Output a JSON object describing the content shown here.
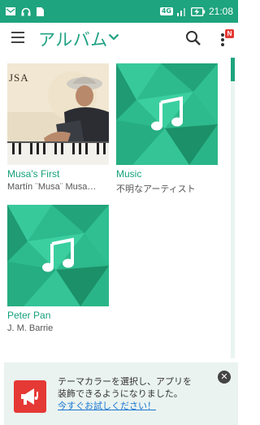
{
  "status_bar": {
    "network_badge": "4G",
    "time": "21:08",
    "icons": [
      "mail-icon",
      "headphones-icon",
      "document-icon",
      "signal-icon",
      "battery-charging-icon"
    ]
  },
  "app_bar": {
    "title": "アルバム",
    "icons": [
      "menu-icon",
      "chevron-down-icon",
      "search-icon",
      "more-vert-icon"
    ],
    "notification_badge": "N",
    "accent_color": "#1fa283"
  },
  "albums": [
    {
      "title": "Musa's First",
      "artist": "Martín ¨Musa¨ Musa…",
      "photo_text": "JSA",
      "cover": "photo"
    },
    {
      "title": "Music",
      "artist": "不明なアーティスト",
      "cover": "music-note"
    },
    {
      "title": "Peter Pan",
      "artist": "J. M. Barrie",
      "cover": "music-note"
    }
  ],
  "banner": {
    "line1": "テーマカラーを選択し、アプリを",
    "line2": "装飾できるようになりました。",
    "link": "今すぐお試しください！",
    "close_label": "✕",
    "icon": "megaphone-icon"
  },
  "colors": {
    "status_bar": "#1ea47e",
    "accent": "#1fa283",
    "banner_bg": "#eaf3ef",
    "banner_icon_bg": "#e53935",
    "link": "#1976d2"
  }
}
